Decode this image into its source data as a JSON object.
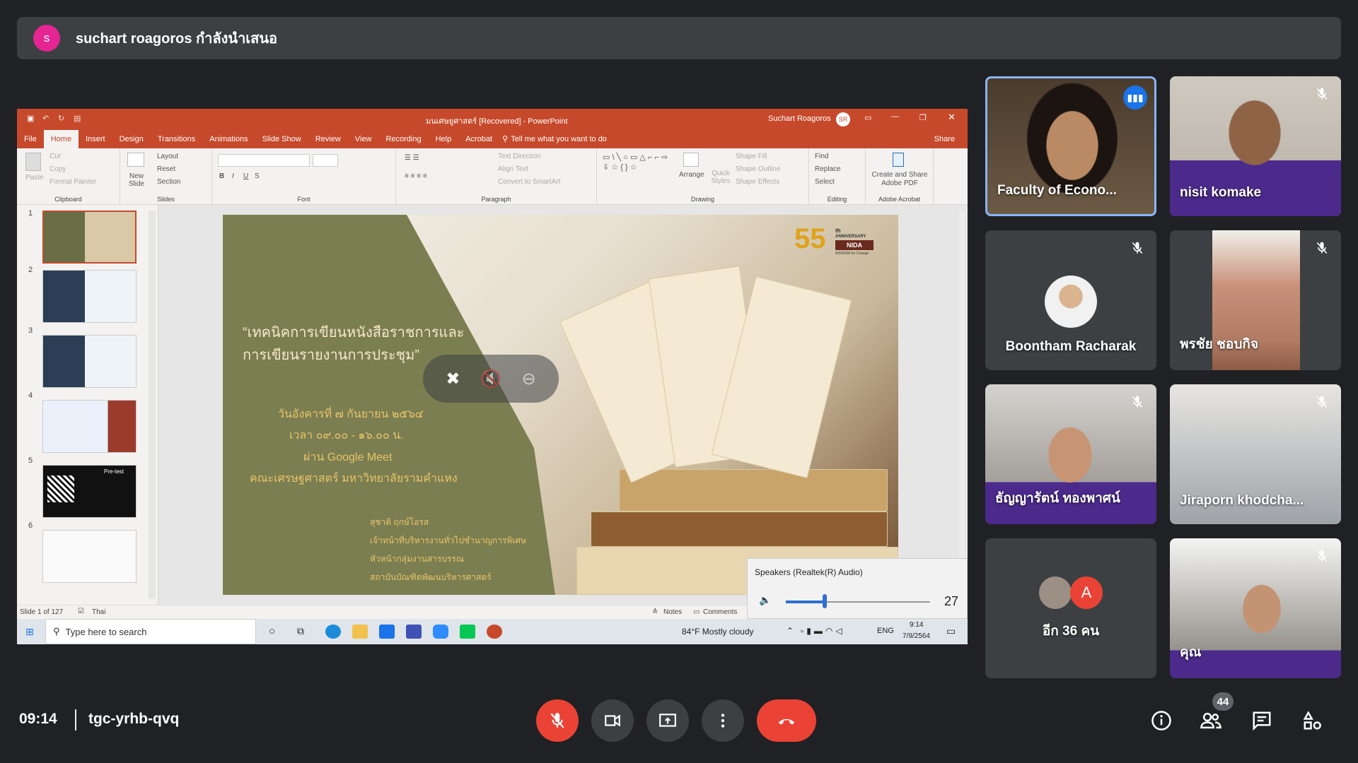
{
  "banner": {
    "avatar_letter": "s",
    "text": "suchart roagoros กำลังนำเสนอ"
  },
  "ppt": {
    "title": "มนเศษยูศาสตร์ [Recovered] - PowerPoint",
    "user": "Suchart Roagoros",
    "user_initials": "SR",
    "tabs": [
      "File",
      "Home",
      "Insert",
      "Design",
      "Transitions",
      "Animations",
      "Slide Show",
      "Review",
      "View",
      "Recording",
      "Help",
      "Acrobat"
    ],
    "tell_me": "Tell me what you want to do",
    "share": "Share",
    "ribbon": {
      "paste": "Paste",
      "cut": "Cut",
      "copy": "Copy",
      "format_painter": "Format Painter",
      "clipboard": "Clipboard",
      "new_slide": "New Slide",
      "layout": "Layout",
      "reset": "Reset",
      "section": "Section",
      "slides": "Slides",
      "font": "Font",
      "text_direction": "Text Direction",
      "align_text": "Align Text",
      "convert_smartart": "Convert to SmartArt",
      "paragraph": "Paragraph",
      "arrange": "Arrange",
      "quick_styles": "Quick Styles",
      "shape_fill": "Shape Fill",
      "shape_outline": "Shape Outline",
      "shape_effects": "Shape Effects",
      "drawing": "Drawing",
      "find": "Find",
      "replace": "Replace",
      "select": "Select",
      "editing": "Editing",
      "create_share_pdf": "Create and Share Adobe PDF",
      "adobe_acrobat": "Adobe Acrobat"
    },
    "thumbnails": [
      "1",
      "2",
      "3",
      "4",
      "5",
      "6"
    ],
    "thumb5_text": "Pre-test",
    "slide": {
      "title_line1": "“เทคนิคการเขียนหนังสือราชการและ",
      "title_line2": "การเขียนรายงานการประชุม”",
      "date": "วันอังคารที่ ๗ กันยายน ๒๕๖๔",
      "time": "เวลา ๐๙.๐๐ - ๑๖.๐๐ น.",
      "via": "ผ่าน Google Meet",
      "faculty": "คณะเศรษฐศาสตร์ มหาวิทยาลัยรามคำแหง",
      "speaker": "สุชาติ ฤกษ์โอรส",
      "speaker_role1": "เจ้าหน้าที่บริหารงานทั่วไปชำนาญการพิเศษ",
      "speaker_role2": "หัวหน้ากลุ่มงานสารบรรณ",
      "speaker_role3": "สถาบันบัณฑิตพัฒนบริหารศาสตร์",
      "logo_number": "55",
      "logo_th": "th",
      "logo_anniversary": "ANNIVERSARY",
      "logo_nida": "NIDA",
      "logo_tagline": "WISDOM for Change"
    },
    "status": {
      "slide_of": "Slide 1 of 127",
      "language": "Thai",
      "notes": "Notes",
      "comments": "Comments"
    },
    "speaker_popup": {
      "label": "Speakers (Realtek(R) Audio)",
      "volume": "27",
      "volume_fraction": 0.27
    }
  },
  "taskbar": {
    "search_placeholder": "Type here to search",
    "weather": "84°F  Mostly cloudy",
    "lang": "ENG",
    "time": "9:14",
    "date": "7/9/2564"
  },
  "participants": [
    {
      "name": "Faculty of Econo...",
      "muted": false,
      "speaking": true
    },
    {
      "name": "nisit komake",
      "muted": true
    },
    {
      "name": "Boontham Racharak",
      "muted": true
    },
    {
      "name": "พรชัย ชอบกิจ",
      "muted": true
    },
    {
      "name": "ธัญญารัตน์ ทองพาศน์",
      "muted": true
    },
    {
      "name": "Jiraporn khodcha...",
      "muted": true
    },
    {
      "name": "อีก 36 คน",
      "avatar_letter": "A"
    },
    {
      "name": "คุณ",
      "muted": true
    }
  ],
  "meeting": {
    "time": "09:14",
    "code": "tgc-yrhb-qvq",
    "participant_count": "44"
  },
  "colors": {
    "accent_red": "#ea4335",
    "ppt_orange": "#c6492b",
    "speaking_blue": "#8ab4f8",
    "slide_green": "#7b7e50"
  }
}
